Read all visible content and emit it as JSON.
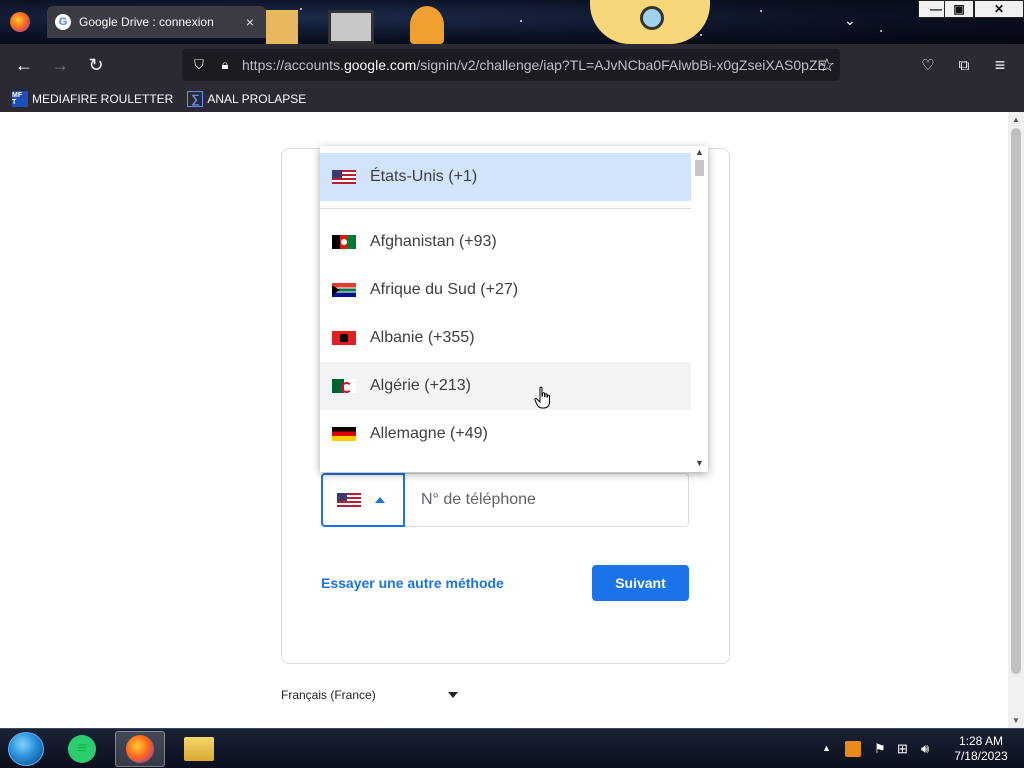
{
  "browser": {
    "tab_title": "Google Drive : connexion",
    "tab_favicon": "G",
    "tab_close": "×",
    "url_prefix": "https://accounts.",
    "url_domain": "google.com",
    "url_path": "/signin/v2/challenge/iap?TL=AJvNCba0FAlwbBi-x0gZseiXAS0pZE",
    "bookmarks": [
      {
        "label": "MEDIAFIRE ROULETTER",
        "icon_text": "MF T"
      },
      {
        "label": "ANAL PROLAPSE",
        "icon_text": "∑"
      }
    ]
  },
  "form": {
    "phone_placeholder": "N° de téléphone",
    "alt_method": "Essayer une autre méthode",
    "next": "Suivant",
    "language": "Français (France)"
  },
  "dropdown": {
    "options": [
      {
        "label": "États-Unis (+1)",
        "flag": "flag-us",
        "state": "selected"
      },
      {
        "label": "Afghanistan (+93)",
        "flag": "flag-af",
        "state": ""
      },
      {
        "label": "Afrique du Sud (+27)",
        "flag": "flag-za",
        "state": ""
      },
      {
        "label": "Albanie (+355)",
        "flag": "flag-al",
        "state": ""
      },
      {
        "label": "Algérie (+213)",
        "flag": "flag-dz",
        "state": "hover"
      },
      {
        "label": "Allemagne (+49)",
        "flag": "flag-de",
        "state": ""
      }
    ]
  },
  "taskbar": {
    "time": "1:28 AM",
    "date": "7/18/2023"
  },
  "colors": {
    "accent": "#1a73e8",
    "selected_bg": "#d2e3fc",
    "hover_bg": "#f1f3f4",
    "chrome_bg": "#2b2a33"
  }
}
